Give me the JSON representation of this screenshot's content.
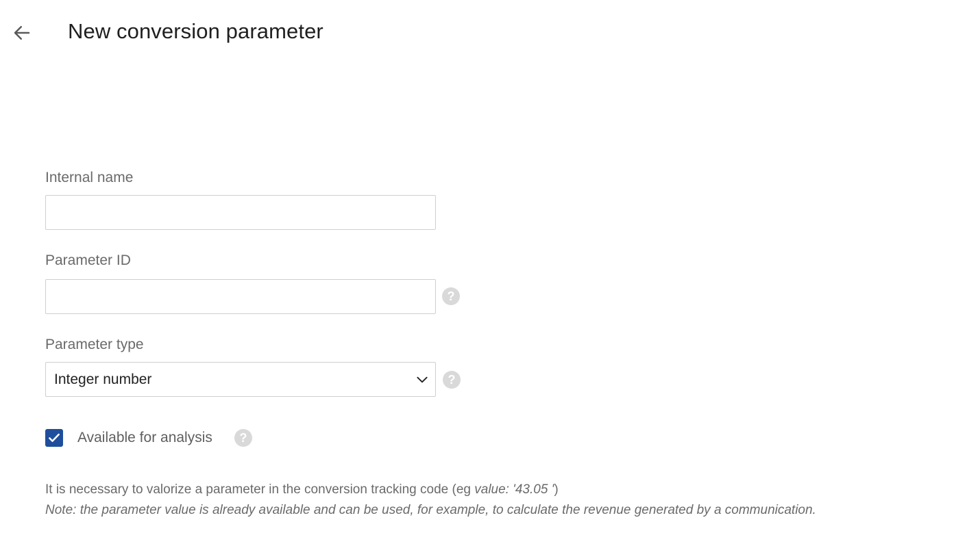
{
  "header": {
    "title": "New conversion parameter"
  },
  "form": {
    "internal_name": {
      "label": "Internal name",
      "value": "",
      "placeholder": ""
    },
    "parameter_id": {
      "label": "Parameter ID",
      "value": "",
      "placeholder": ""
    },
    "parameter_type": {
      "label": "Parameter type",
      "selected": "Integer number"
    },
    "available_for_analysis": {
      "label": "Available for analysis",
      "checked": true
    },
    "help_glyph": "?"
  },
  "info": {
    "line1_prefix": "It is necessary to valorize a parameter in the conversion tracking code (eg ",
    "line1_example": "value: '43.05 '",
    "line1_suffix": ")",
    "line2": "Note: the parameter value is already available and can be used, for example, to calculate the revenue generated by a communication."
  },
  "icons": {
    "back": "arrow-left-icon",
    "dropdown": "chevron-down-icon",
    "help": "question-mark-icon",
    "check": "checkmark-icon"
  },
  "colors": {
    "accent": "#1f4e9c",
    "help_icon_bg": "#d9d9d9",
    "input_border": "#cfcfcf",
    "title": "#1f1f1f",
    "label": "#6a6a6a"
  }
}
